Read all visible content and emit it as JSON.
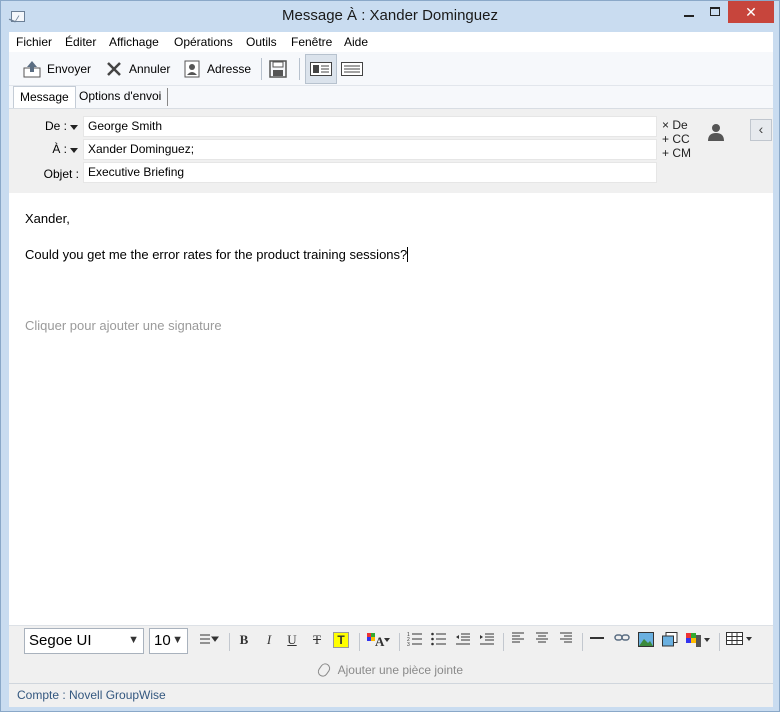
{
  "window": {
    "title": "Message À : Xander Dominguez",
    "minimize_glyph": "",
    "maximize_glyph": "",
    "close_glyph": "✕"
  },
  "menu": [
    "Fichier",
    "Éditer",
    "Affichage",
    "Opérations",
    "Outils",
    "Fenêtre",
    "Aide"
  ],
  "toolbar": {
    "send_label": "Envoyer",
    "cancel_label": "Annuler",
    "address_label": "Adresse"
  },
  "tabs": {
    "message": "Message",
    "send_options": "Options d'envoi"
  },
  "header": {
    "from_label": "De :",
    "from_value": "George Smith",
    "to_label": "À :",
    "to_value": "Xander Dominguez;",
    "subject_label": "Objet :",
    "subject_value": "Executive Briefing",
    "opt_from": "De",
    "opt_cc": "CC",
    "opt_bc": "CM",
    "opt_from_prefix": "×",
    "opt_cc_prefix": "+",
    "opt_bc_prefix": "+",
    "collapse_glyph": "‹"
  },
  "body": {
    "greeting": "Xander,",
    "text": "Could you get me the error rates for the product training sessions?",
    "signature_placeholder": "Cliquer pour ajouter une signature"
  },
  "format": {
    "font": "Segoe UI",
    "size": "10",
    "bold": "B",
    "italic": "I",
    "underline": "U",
    "strike": "T",
    "highlight": "T"
  },
  "attach_label": "Ajouter une pièce jointe",
  "status": "Compte : Novell GroupWise",
  "colors": {
    "titlebar": "#c9dcf0",
    "close_button": "#c7453c",
    "status_text": "#33577f",
    "highlight": "#ffff00"
  }
}
